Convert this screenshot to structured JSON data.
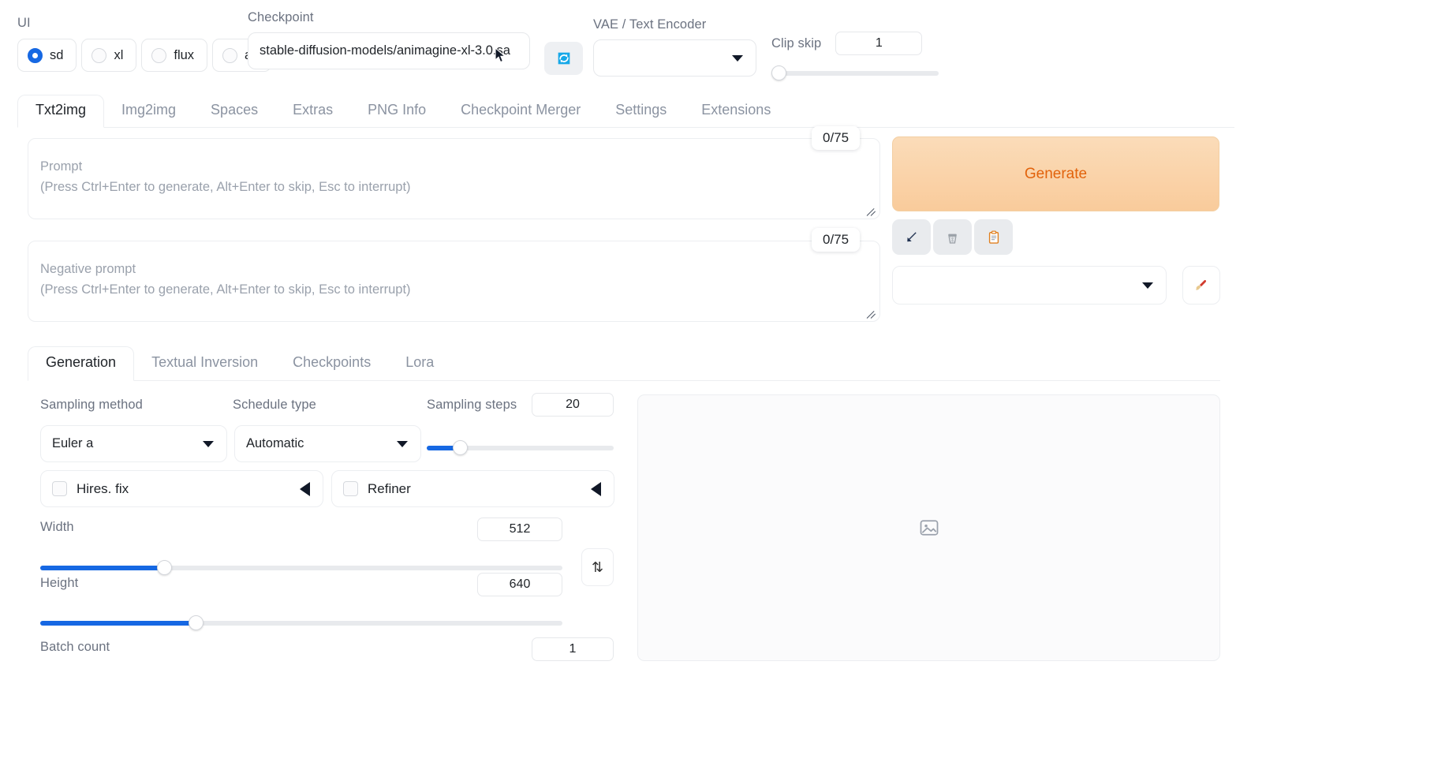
{
  "topbar": {
    "ui_label": "UI",
    "ui_options": [
      {
        "label": "sd",
        "selected": true
      },
      {
        "label": "xl",
        "selected": false
      },
      {
        "label": "flux",
        "selected": false
      },
      {
        "label": "all",
        "selected": false
      }
    ],
    "checkpoint_label": "Checkpoint",
    "checkpoint_value": "stable-diffusion-models/animagine-xl-3.0.sa",
    "refresh_icon": "refresh-icon",
    "vae_label": "VAE / Text Encoder",
    "vae_value": "",
    "clip_skip_label": "Clip skip",
    "clip_skip_value": "1"
  },
  "main_tabs": [
    {
      "label": "Txt2img",
      "active": true
    },
    {
      "label": "Img2img",
      "active": false
    },
    {
      "label": "Spaces",
      "active": false
    },
    {
      "label": "Extras",
      "active": false
    },
    {
      "label": "PNG Info",
      "active": false
    },
    {
      "label": "Checkpoint Merger",
      "active": false
    },
    {
      "label": "Settings",
      "active": false
    },
    {
      "label": "Extensions",
      "active": false
    }
  ],
  "prompt": {
    "label": "Prompt",
    "hint": "(Press Ctrl+Enter to generate, Alt+Enter to skip, Esc to interrupt)",
    "value": "",
    "token_count": "0/75"
  },
  "negative_prompt": {
    "label": "Negative prompt",
    "hint": "(Press Ctrl+Enter to generate, Alt+Enter to skip, Esc to interrupt)",
    "value": "",
    "token_count": "0/75"
  },
  "actions": {
    "generate_label": "Generate",
    "generate_color": "#e2630c",
    "buttons": [
      {
        "name": "read-generation-params-icon",
        "glyph": "↙"
      },
      {
        "name": "clear-prompt-icon",
        "glyph": "🗑"
      },
      {
        "name": "apply-style-icon",
        "glyph": "📋"
      }
    ],
    "styles_value": "",
    "brush_icon": "🖌"
  },
  "sub_tabs": [
    {
      "label": "Generation",
      "active": true
    },
    {
      "label": "Textual Inversion",
      "active": false
    },
    {
      "label": "Checkpoints",
      "active": false
    },
    {
      "label": "Lora",
      "active": false
    }
  ],
  "generation": {
    "sampling_method_label": "Sampling method",
    "sampling_method_value": "Euler a",
    "schedule_type_label": "Schedule type",
    "schedule_type_value": "Automatic",
    "sampling_steps_label": "Sampling steps",
    "sampling_steps_value": "20",
    "hires_fix_label": "Hires. fix",
    "hires_fix_checked": false,
    "refiner_label": "Refiner",
    "refiner_checked": false,
    "width_label": "Width",
    "width_value": "512",
    "height_label": "Height",
    "height_value": "640",
    "batch_count_label": "Batch count",
    "batch_count_value": "1",
    "swap_icon": "⇅"
  },
  "gallery": {
    "placeholder_icon": "image-placeholder-icon"
  }
}
